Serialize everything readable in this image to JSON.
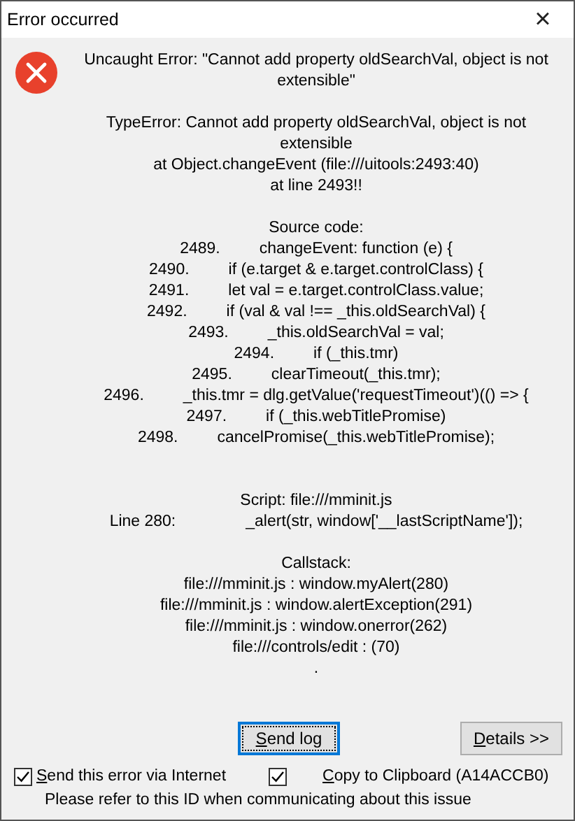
{
  "window": {
    "title": "Error occurred",
    "close": "×"
  },
  "message": "Uncaught Error: \"Cannot add property oldSearchVal, object is not extensible\"",
  "details": [
    "TypeError: Cannot add property oldSearchVal, object is not extensible",
    "at Object.changeEvent (file:///uitools:2493:40)",
    "at line 2493!!"
  ],
  "source_heading": "Source code:",
  "source_lines": [
    {
      "number": "2489.",
      "code": "changeEvent: function (e) {"
    },
    {
      "number": "2490.",
      "code": "if (e.target & e.target.controlClass) {"
    },
    {
      "number": "2491.",
      "code": "let val = e.target.controlClass.value;"
    },
    {
      "number": "2492.",
      "code": "if (val & val !== _this.oldSearchVal) {"
    },
    {
      "number": "2493.",
      "code": "_this.oldSearchVal = val;"
    },
    {
      "number": "2494.",
      "code": "if (_this.tmr)"
    },
    {
      "number": "2495.",
      "code": "clearTimeout(_this.tmr);"
    },
    {
      "number": "2496.",
      "code": "_this.tmr = dlg.getValue('requestTimeout')(() => {"
    },
    {
      "number": "2497.",
      "code": "if (_this.webTitlePromise)"
    },
    {
      "number": "2498.",
      "code": "cancelPromise(_this.webTitlePromise);"
    }
  ],
  "script": "Script: file:///mminit.js",
  "script_line": {
    "label": "Line 280:",
    "code": "_alert(str, window['__lastScriptName']);"
  },
  "callstack_heading": "Callstack:",
  "callstack": [
    "file:///mminit.js : window.myAlert(280)",
    "file:///mminit.js : window.alertException(291)",
    "file:///mminit.js : window.onerror(262)",
    "file:///controls/edit : (70)",
    "."
  ],
  "buttons": [
    {
      "label": "Send log",
      "focused": true
    },
    {
      "label": "Details >>",
      "focused": false
    }
  ],
  "options": [
    {
      "label": "Send this error via Internet",
      "checked": true
    },
    {
      "label": "Copy to Clipboard (A14ACCB0)",
      "checked": true
    }
  ],
  "note": "Please refer to this ID when communicating about this issue"
}
